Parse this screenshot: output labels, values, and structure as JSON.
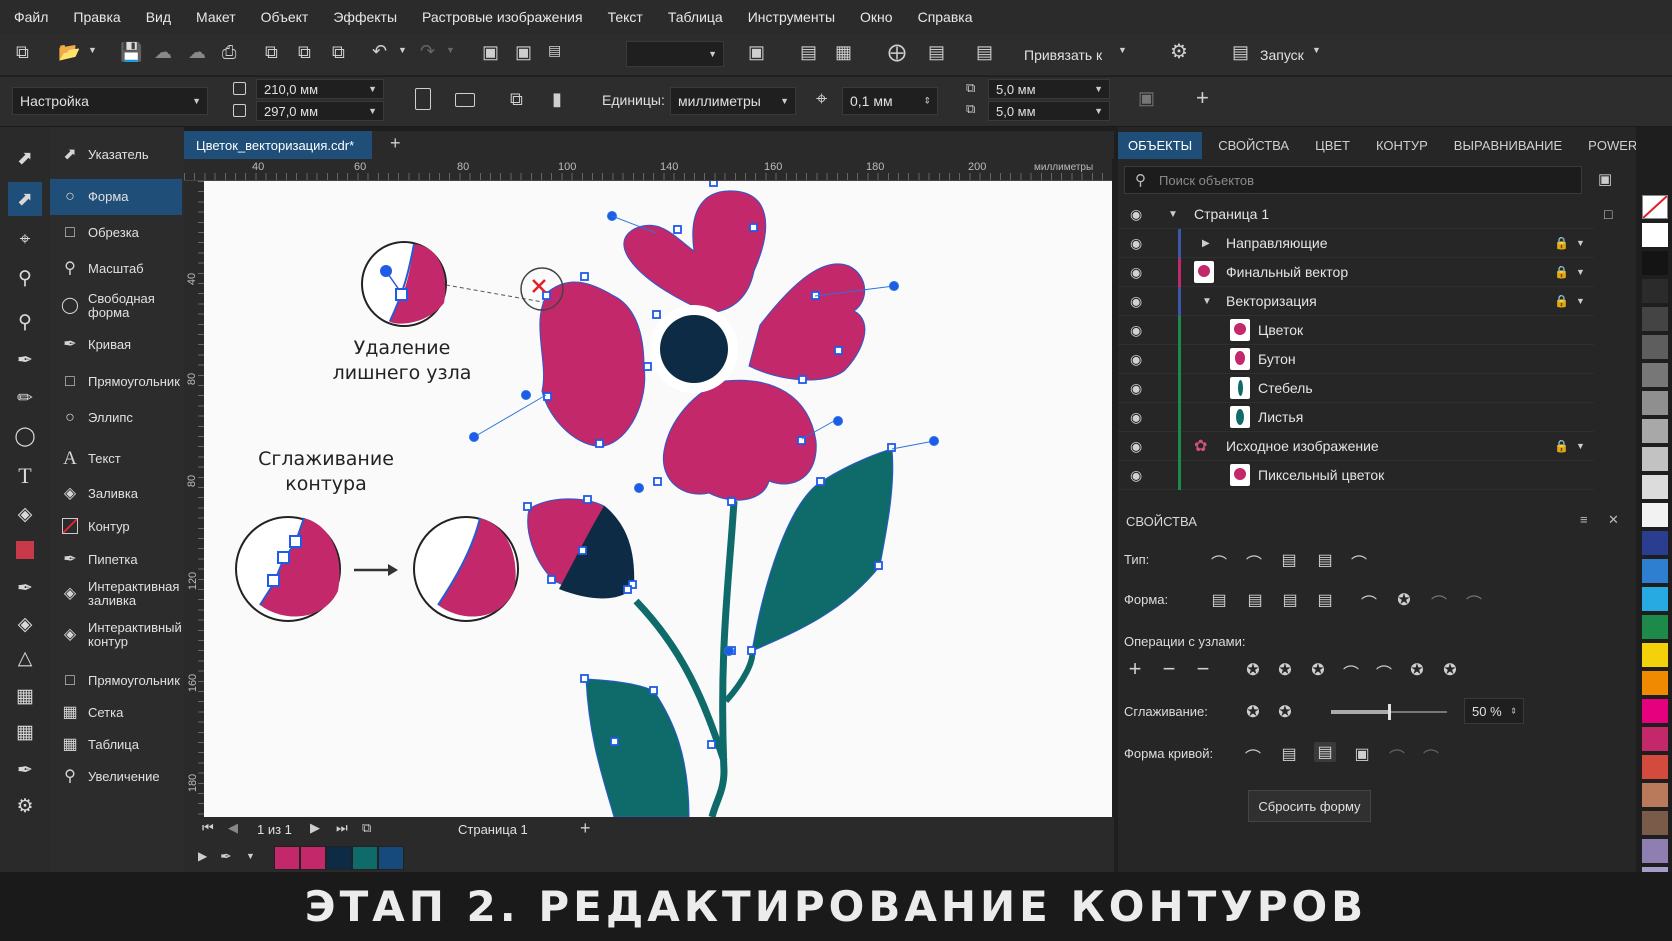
{
  "menu": [
    "Файл",
    "Правка",
    "Вид",
    "Макет",
    "Объект",
    "Эффекты",
    "Растровые изображения",
    "Текст",
    "Таблица",
    "Инструменты",
    "Окно",
    "Справка"
  ],
  "toolbar": {
    "snap_label": "Привязать к",
    "launch_label": "Запуск"
  },
  "propbar": {
    "preset": "Настройка",
    "width": "210,0 мм",
    "height": "297,0 мм",
    "units_label": "Единицы:",
    "units_value": "миллиметры",
    "nudge": "0,1 мм",
    "dup_x": "5,0 мм",
    "dup_y": "5,0 мм"
  },
  "tools": [
    {
      "icon": "pick-icon",
      "label": "Указатель"
    },
    {
      "icon": "shape-icon",
      "label": "Форма"
    },
    {
      "icon": "crop-icon",
      "label": "Обрезка"
    },
    {
      "icon": "zoom-icon",
      "label": "Масштаб"
    },
    {
      "icon": "freehand-icon",
      "label": "Свободная форма"
    },
    {
      "icon": "curve-icon",
      "label": "Кривая"
    },
    {
      "icon": "rectangle-icon",
      "label": "Прямоугольник"
    },
    {
      "icon": "ellipse-icon",
      "label": "Эллипс"
    },
    {
      "icon": "text-icon",
      "label": "Текст"
    },
    {
      "icon": "fill-icon",
      "label": "Заливка"
    },
    {
      "icon": "outline-icon",
      "label": "Контур"
    },
    {
      "icon": "eyedropper-icon",
      "label": "Пипетка"
    },
    {
      "icon": "interactive-fill-icon",
      "label": "Интерактивная заливка"
    },
    {
      "icon": "interactive-outline-icon",
      "label": "Интерактивный контур"
    },
    {
      "icon": "rectangle-icon",
      "label": "Прямоугольник"
    },
    {
      "icon": "grid-icon",
      "label": "Сетка"
    },
    {
      "icon": "table-icon",
      "label": "Таблица"
    },
    {
      "icon": "magnify-icon",
      "label": "Увеличение"
    }
  ],
  "document_tab": "Цветок_векторизация.cdr*",
  "ruler_h": [
    "40",
    "60",
    "80",
    "100",
    "140",
    "160",
    "180",
    "200"
  ],
  "ruler_units": "миллиметры",
  "ruler_v": [
    "40",
    "80",
    "80",
    "120",
    "160",
    "180"
  ],
  "canvas": {
    "note1_line1": "Удаление",
    "note1_line2": "лишнего узла",
    "note2_line1": "Сглаживание",
    "note2_line2": "контура"
  },
  "status": {
    "pages": "1 из 1",
    "page_tab": "Страница 1"
  },
  "swatch_colors": [
    "#c2286a",
    "#c2286a",
    "#0d2b44",
    "#0f6b6a",
    "#174a7c"
  ],
  "right_tabs": [
    "ОБЪЕКТЫ",
    "СВОЙСТВА",
    "ЦВЕТ",
    "КОНТУР",
    "ВЫРАВНИВАНИЕ",
    "POWERTRACE"
  ],
  "search_placeholder": "Поиск объектов",
  "objects": [
    {
      "label": "Страница 1"
    },
    {
      "label": "Направляющие"
    },
    {
      "label": "Финальный вектор"
    },
    {
      "label": "Векторизация"
    },
    {
      "label": "Цветок"
    },
    {
      "label": "Бутон"
    },
    {
      "label": "Стебель"
    },
    {
      "label": "Листья"
    },
    {
      "label": "Исходное изображение"
    },
    {
      "label": "Пиксельный цветок"
    }
  ],
  "properties": {
    "header": "СВОЙСТВА",
    "type_label": "Тип:",
    "shape_label": "Форма:",
    "node_ops_label": "Операции с узлами:",
    "smoothing_label": "Сглаживание:",
    "smoothing_value": "50 %",
    "curve_shape_label": "Форма кривой:",
    "reset_button": "Сбросить форму"
  },
  "palette": [
    "#ffffff",
    "#141414",
    "#2b2b2b",
    "#444444",
    "#5e5e5e",
    "#777777",
    "#8f8f8f",
    "#a8a8a8",
    "#c2c2c2",
    "#dcdcdc",
    "#f2f2f2",
    "#2a3d8f",
    "#2f7fd0",
    "#27a9e1",
    "#1e8a4a",
    "#f5d10a",
    "#f08a00",
    "#e6007e",
    "#c2286a",
    "#d24b3c",
    "#b87a5b",
    "#7a5a48",
    "#8f7fb0",
    "#a89cc8",
    "#6a6aa8",
    "#5a5a9a"
  ],
  "caption": "ЭТАП 2. РЕДАКТИРОВАНИЕ КОНТУРОВ"
}
